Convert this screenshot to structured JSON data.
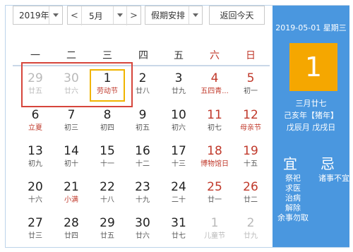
{
  "toolbar": {
    "year_label": "2019年",
    "prev_arrow": "<",
    "month_label": "5月",
    "next_arrow": ">",
    "holiday_label": "假期安排",
    "today_button": "返回今天"
  },
  "weekdays": [
    "一",
    "二",
    "三",
    "四",
    "五",
    "六",
    "日"
  ],
  "weeks": [
    [
      {
        "num": "29",
        "sub": "廿五",
        "other": true
      },
      {
        "num": "30",
        "sub": "廿六",
        "other": true
      },
      {
        "num": "1",
        "sub": "劳动节",
        "today": true
      },
      {
        "num": "2",
        "sub": "廿八"
      },
      {
        "num": "3",
        "sub": "廿九"
      },
      {
        "num": "4",
        "sub": "五四青...",
        "red": true
      },
      {
        "num": "5",
        "sub": "初一"
      }
    ],
    [
      {
        "num": "6",
        "sub": "立夏",
        "red": true
      },
      {
        "num": "7",
        "sub": "初三"
      },
      {
        "num": "8",
        "sub": "初四"
      },
      {
        "num": "9",
        "sub": "初五"
      },
      {
        "num": "10",
        "sub": "初六"
      },
      {
        "num": "11",
        "sub": "初七"
      },
      {
        "num": "12",
        "sub": "母亲节",
        "red": true
      }
    ],
    [
      {
        "num": "13",
        "sub": "初九"
      },
      {
        "num": "14",
        "sub": "初十"
      },
      {
        "num": "15",
        "sub": "十一"
      },
      {
        "num": "16",
        "sub": "十二"
      },
      {
        "num": "17",
        "sub": "十三"
      },
      {
        "num": "18",
        "sub": "博物馆日",
        "red": true
      },
      {
        "num": "19",
        "sub": "十五"
      }
    ],
    [
      {
        "num": "20",
        "sub": "十六"
      },
      {
        "num": "21",
        "sub": "小满",
        "red": true
      },
      {
        "num": "22",
        "sub": "十八"
      },
      {
        "num": "23",
        "sub": "十九"
      },
      {
        "num": "24",
        "sub": "二十"
      },
      {
        "num": "25",
        "sub": "廿一"
      },
      {
        "num": "26",
        "sub": "廿二"
      }
    ],
    [
      {
        "num": "27",
        "sub": "廿三"
      },
      {
        "num": "28",
        "sub": "廿四"
      },
      {
        "num": "29",
        "sub": "廿五"
      },
      {
        "num": "30",
        "sub": "廿六"
      },
      {
        "num": "31",
        "sub": "廿七"
      },
      {
        "num": "1",
        "sub": "儿童节",
        "other": true
      },
      {
        "num": "2",
        "sub": "廿九",
        "other": true
      }
    ]
  ],
  "panel": {
    "date_line": "2019-05-01 星期三",
    "big_day": "1",
    "lunar_date": "三月廿七",
    "year_ganzhi": "己亥年【猪年】",
    "month_day_ganzhi": "戊辰月 戊戌日",
    "yi_title": "宜",
    "ji_title": "忌",
    "yi_items": [
      "祭祀",
      "求医",
      "治病",
      "解除",
      "余事勿取"
    ],
    "ji_items": [
      "诸事不宜"
    ]
  },
  "colors": {
    "panel_bg": "#4a97df",
    "today_border": "#f0b400",
    "big_day_bg": "#f5a700",
    "highlight_box": "#d6453b",
    "weekend_red": "#c0392b"
  }
}
